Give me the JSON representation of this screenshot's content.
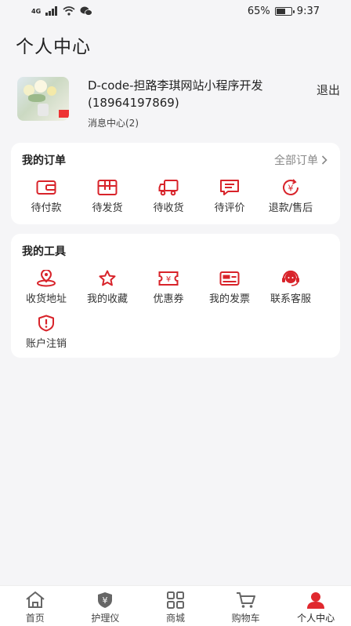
{
  "status_bar": {
    "network": "4G",
    "battery_percent": "65%",
    "time": "9:37",
    "battery_level": 0.65
  },
  "page_title": "个人中心",
  "profile": {
    "username": "D-code-担路李琪网站小程序开发(18964197869)",
    "messages": "消息中心(2)",
    "logout": "退出"
  },
  "orders": {
    "title": "我的订单",
    "all_label": "全部订单",
    "items": [
      {
        "label": "待付款",
        "icon": "wallet-icon"
      },
      {
        "label": "待发货",
        "icon": "package-icon"
      },
      {
        "label": "待收货",
        "icon": "truck-icon"
      },
      {
        "label": "待评价",
        "icon": "comment-icon"
      },
      {
        "label": "退款/售后",
        "icon": "refund-icon"
      }
    ]
  },
  "tools": {
    "title": "我的工具",
    "items": [
      {
        "label": "收货地址",
        "icon": "location-icon"
      },
      {
        "label": "我的收藏",
        "icon": "star-icon"
      },
      {
        "label": "优惠券",
        "icon": "coupon-icon"
      },
      {
        "label": "我的发票",
        "icon": "invoice-icon"
      },
      {
        "label": "联系客服",
        "icon": "headset-icon"
      },
      {
        "label": "账户注销",
        "icon": "shield-alert-icon"
      }
    ]
  },
  "tabs": [
    {
      "label": "首页",
      "icon": "home-icon"
    },
    {
      "label": "护理仪",
      "icon": "device-icon"
    },
    {
      "label": "商城",
      "icon": "grid-icon"
    },
    {
      "label": "购物车",
      "icon": "cart-icon"
    },
    {
      "label": "个人中心",
      "icon": "user-icon",
      "active": true
    }
  ],
  "colors": {
    "accent": "#d8232a",
    "tab_icon": "#666666",
    "active_tab": "#e0282e"
  }
}
